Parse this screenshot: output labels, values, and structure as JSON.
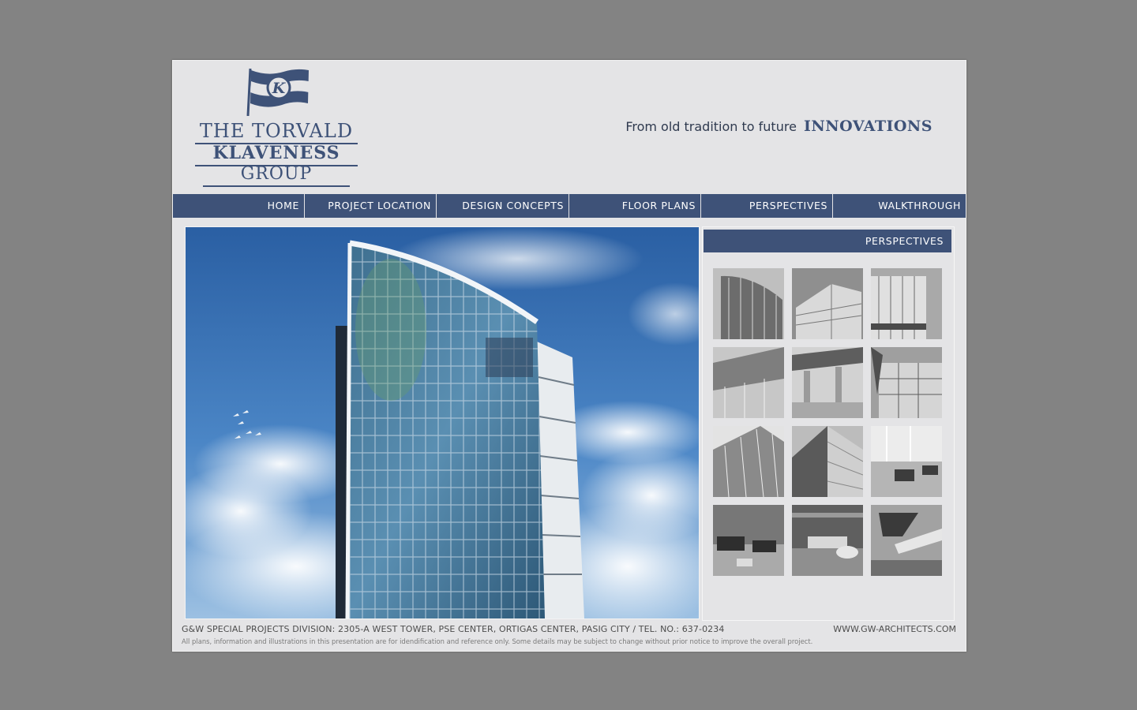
{
  "brand": {
    "logo_line1": "THE TORVALD",
    "logo_line2": "KLAVENESS",
    "logo_line3": "GROUP",
    "flag_letter": "K",
    "accent_color": "#3e5278"
  },
  "header": {
    "tagline": "From old tradition to future",
    "tagline_emphasis": "INNOVATIONS"
  },
  "nav": {
    "items": [
      {
        "label": "HOME"
      },
      {
        "label": "PROJECT LOCATION"
      },
      {
        "label": "DESIGN CONCEPTS"
      },
      {
        "label": "FLOOR PLANS"
      },
      {
        "label": "PERSPECTIVES"
      },
      {
        "label": "WALKTHROUGH"
      }
    ]
  },
  "panel": {
    "title": "PERSPECTIVES",
    "thumbnails": [
      {
        "icon": "tower-curve-photo"
      },
      {
        "icon": "building-corner-photo"
      },
      {
        "icon": "entrance-facade-photo"
      },
      {
        "icon": "lobby-exterior-photo"
      },
      {
        "icon": "canopy-photo"
      },
      {
        "icon": "street-level-photo"
      },
      {
        "icon": "glass-facade-up-photo"
      },
      {
        "icon": "facade-angle-photo"
      },
      {
        "icon": "lounge-interior-photo"
      },
      {
        "icon": "lounge-seating-photo"
      },
      {
        "icon": "reception-interior-photo"
      },
      {
        "icon": "staircase-interior-photo"
      }
    ]
  },
  "footer": {
    "address": "G&W SPECIAL PROJECTS DIVISION: 2305-A WEST TOWER, PSE CENTER, ORTIGAS CENTER, PASIG CITY / TEL. NO.: 637-0234",
    "website": "WWW.GW-ARCHITECTS.COM",
    "disclaimer": "All plans, information and illustrations in this presentation are for idendification and reference only. Some details may be subject to change without prior notice to improve the overall project."
  }
}
